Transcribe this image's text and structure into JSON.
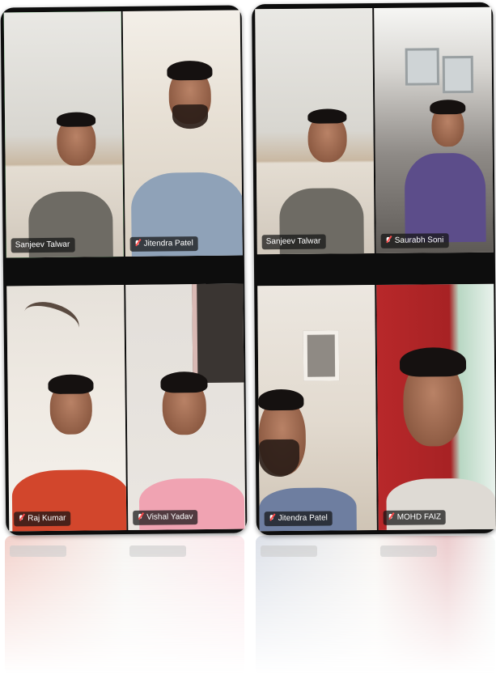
{
  "left_panel": {
    "tiles": [
      {
        "name": "Sanjeev Talwar",
        "muted": false,
        "active_speaker": true
      },
      {
        "name": "Jitendra Patel",
        "muted": true,
        "active_speaker": false
      },
      {
        "name": "Raj Kumar",
        "muted": true,
        "active_speaker": false
      },
      {
        "name": "Vishal Yadav",
        "muted": true,
        "active_speaker": false
      }
    ]
  },
  "right_panel": {
    "tiles": [
      {
        "name": "Sanjeev Talwar",
        "muted": false,
        "active_speaker": false
      },
      {
        "name": "Saurabh Soni",
        "muted": true,
        "active_speaker": false
      },
      {
        "name": "Jitendra Patel",
        "muted": true,
        "active_speaker": false
      },
      {
        "name": "MOHD FAIZ",
        "muted": true,
        "active_speaker": false
      }
    ]
  },
  "colors": {
    "active_speaker_border": "#3ecf5a",
    "panel_background": "#0d0d0d",
    "name_tag_background": "rgba(20,20,20,0.72)",
    "muted_mic": "#ff4d4d"
  },
  "icons": {
    "muted": "mic-muted-icon"
  }
}
